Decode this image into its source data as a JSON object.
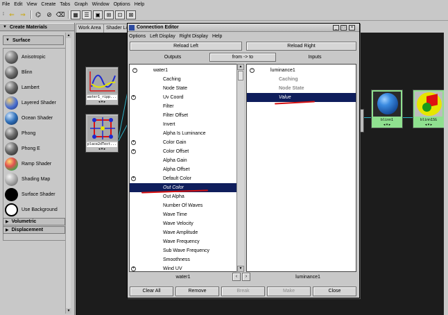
{
  "menubar": [
    "File",
    "Edit",
    "View",
    "Create",
    "Tabs",
    "Graph",
    "Window",
    "Options",
    "Help"
  ],
  "left_panel": {
    "title": "Create Materials",
    "section_surface": "Surface",
    "shaders": [
      {
        "label": "Anisotropic",
        "color": "#7a7a7a"
      },
      {
        "label": "Blinn",
        "color": "#6e6e6e"
      },
      {
        "label": "Lambert",
        "color": "#6a6a6a"
      },
      {
        "label": "Layered Shader",
        "color": "#4a6fd0"
      },
      {
        "label": "Ocean Shader",
        "color": "#2f6fb8"
      },
      {
        "label": "Phong",
        "color": "#6a6a6a"
      },
      {
        "label": "Phong E",
        "color": "#6a6a6a"
      },
      {
        "label": "Ramp Shader",
        "color": "#e05050"
      },
      {
        "label": "Shading Map",
        "color": "#9a9a9a"
      },
      {
        "label": "Surface Shader",
        "color": "#000000"
      },
      {
        "label": "Use Background",
        "color": "#ffffff"
      }
    ],
    "section_volumetric": "Volumetric",
    "section_displacement": "Displacement"
  },
  "tabs": {
    "work_area": "Work Area",
    "shader_lib": "Shader Li"
  },
  "nodes": {
    "water": {
      "label": "water1_ripp..."
    },
    "place": {
      "label": "place2dText..."
    },
    "blinn": {
      "label": "blinn1"
    },
    "blinnsg": {
      "label": "blinn1SG"
    }
  },
  "editor": {
    "title": "Connection Editor",
    "menu": [
      "Options",
      "Left Display",
      "Right Display",
      "Help"
    ],
    "reload_left": "Reload Left",
    "reload_right": "Reload Right",
    "outputs": "Outputs",
    "direction": "from -> to",
    "inputs": "Inputs",
    "left_root": "water1",
    "left_items": [
      {
        "label": "Caching",
        "expand": false
      },
      {
        "label": "Node State",
        "expand": false
      },
      {
        "label": "Uv Coord",
        "expand": true
      },
      {
        "label": "Filter",
        "expand": false
      },
      {
        "label": "Filter Offset",
        "expand": false
      },
      {
        "label": "Invert",
        "expand": false
      },
      {
        "label": "Alpha Is Luminance",
        "expand": false
      },
      {
        "label": "Color Gain",
        "expand": true
      },
      {
        "label": "Color Offset",
        "expand": true
      },
      {
        "label": "Alpha Gain",
        "expand": false
      },
      {
        "label": "Alpha Offset",
        "expand": false
      },
      {
        "label": "Default Color",
        "expand": true
      },
      {
        "label": "Out Color",
        "expand": false,
        "selected": true
      },
      {
        "label": "Out Alpha",
        "expand": false
      },
      {
        "label": "Number Of Waves",
        "expand": false
      },
      {
        "label": "Wave Time",
        "expand": false
      },
      {
        "label": "Wave Velocity",
        "expand": false
      },
      {
        "label": "Wave Amplitude",
        "expand": false
      },
      {
        "label": "Wave Frequency",
        "expand": false
      },
      {
        "label": "Sub Wave Frequency",
        "expand": false
      },
      {
        "label": "Smoothness",
        "expand": false
      },
      {
        "label": "Wind UV",
        "expand": true
      }
    ],
    "right_root": "luminance1",
    "right_items": [
      {
        "label": "Caching",
        "gray": true
      },
      {
        "label": "Node State",
        "gray": true
      },
      {
        "label": "Value",
        "selected": true
      }
    ],
    "left_node_name": "water1",
    "right_node_name": "luminance1",
    "buttons": {
      "clear_all": "Clear All",
      "remove": "Remove",
      "break": "Break",
      "make": "Make",
      "close": "Close"
    },
    "highlight_color": "#0f1e5c",
    "annotation_color": "#d51010"
  }
}
